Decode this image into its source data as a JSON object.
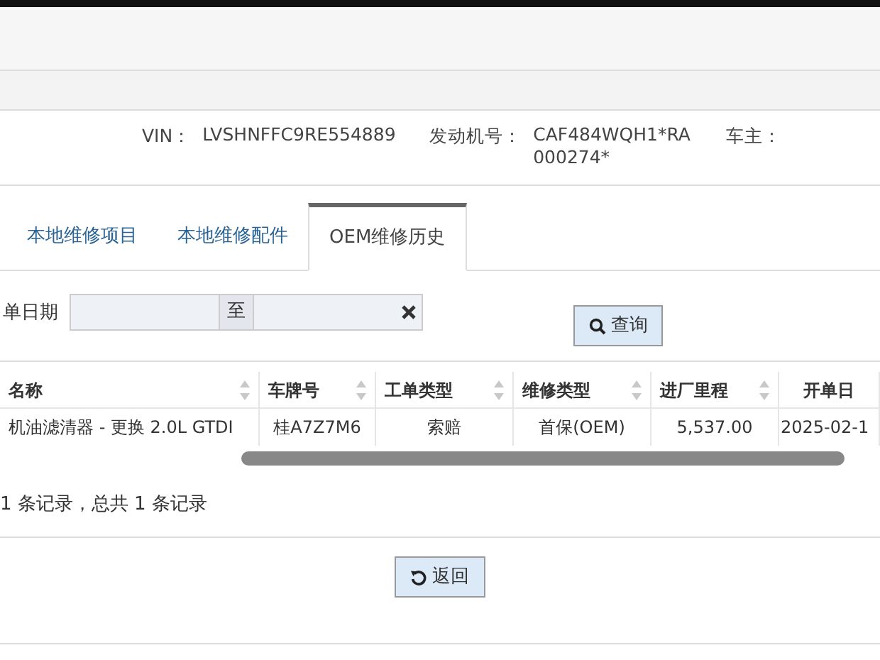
{
  "vehicle_info": [
    {
      "label": "VIN：",
      "value": "LVSHNFFC9RE554889"
    },
    {
      "label": "发动机号：",
      "value": "CAF484WQH1*RA000274*"
    },
    {
      "label": "车主："
    }
  ],
  "tabs": [
    {
      "label": "本地维修项目",
      "selected": false
    },
    {
      "label": "本地维修配件",
      "selected": false
    },
    {
      "label": "OEM维修历史",
      "selected": true
    }
  ],
  "filter": {
    "label": "单日期",
    "separator": "至",
    "search_button": "查询"
  },
  "table": {
    "columns": [
      {
        "label": "名称",
        "sortable": true
      },
      {
        "label": "车牌号",
        "sortable": true
      },
      {
        "label": "工单类型",
        "sortable": true
      },
      {
        "label": "维修类型",
        "sortable": true
      },
      {
        "label": "进厂里程",
        "sortable": true
      },
      {
        "label": "开单日",
        "sortable": false
      }
    ],
    "rows": [
      [
        "机油滤清器 - 更换 2.0L GTDI",
        "桂A7Z7M6",
        "索赔",
        "首保(OEM)",
        "5,537.00",
        "2025-02-1"
      ]
    ]
  },
  "pager_text": "1 条记录，总共 1 条记录",
  "back_button": "返回"
}
